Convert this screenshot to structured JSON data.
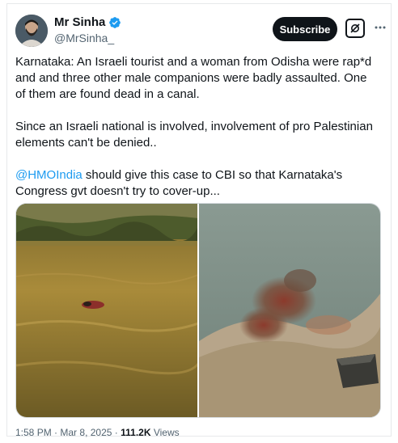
{
  "author": {
    "display_name": "Mr Sinha",
    "handle": "@MrSinha_",
    "verified": true
  },
  "actions": {
    "subscribe_label": "Subscribe",
    "grok_icon": "grok-icon",
    "more_icon": "more-dots-icon"
  },
  "tweet": {
    "paragraph1": "Karnataka: An Israeli tourist and a woman from Odisha were rap*d and and three other male companions were badly assaulted. One of them are found dead in a canal.",
    "paragraph2": "Since an Israeli national is involved, involvement of pro Palestinian elements can't be denied..",
    "mention": "@HMOIndia",
    "paragraph3_rest": " should give this case to CBI so that Karnataka's Congress gvt doesn't try to cover-up..."
  },
  "media": [
    {
      "name": "canal-water-photo"
    },
    {
      "name": "canal-bank-blurred-photo"
    }
  ],
  "meta": {
    "time": "1:58 PM",
    "date": "Mar 8, 2025",
    "separator": "·",
    "views_count": "111.2K",
    "views_label": "Views"
  },
  "colors": {
    "text": "#0f1419",
    "secondary": "#536471",
    "link": "#1d9bf0",
    "verified": "#1d9bf0"
  }
}
